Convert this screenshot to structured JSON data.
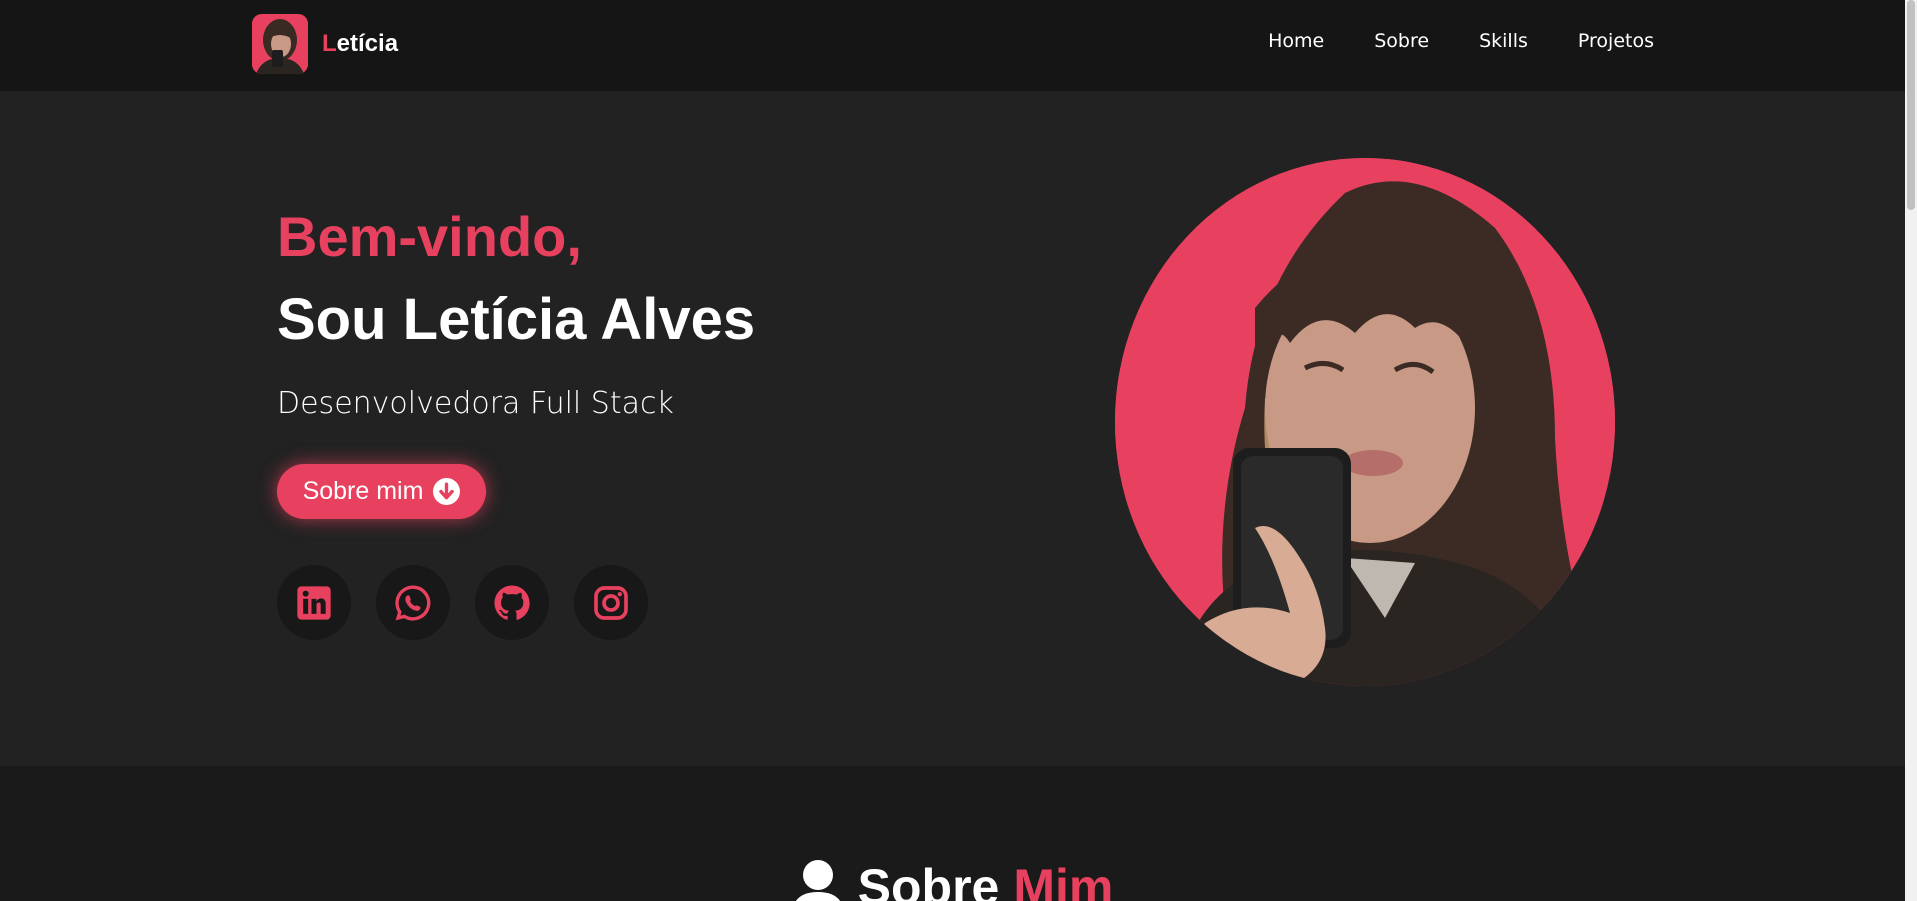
{
  "brand": {
    "first_letter": "L",
    "rest": "etícia",
    "logo_icon": "profile-photo"
  },
  "nav": {
    "items": [
      {
        "label": "Home"
      },
      {
        "label": "Sobre"
      },
      {
        "label": "Skills"
      },
      {
        "label": "Projetos"
      }
    ]
  },
  "hero": {
    "greeting": "Bem-vindo,",
    "name": "Sou Letícia Alves",
    "role": "Desenvolvedora Full Stack",
    "cta_label": "Sobre mim",
    "cta_icon": "arrow-circle-down-icon",
    "photo": "profile-photo",
    "socials": [
      {
        "icon": "linkedin-icon"
      },
      {
        "icon": "whatsapp-icon"
      },
      {
        "icon": "github-icon"
      },
      {
        "icon": "instagram-icon"
      }
    ]
  },
  "about": {
    "icon": "user-icon",
    "title_part1": "Sobre",
    "title_part2": "Mim"
  },
  "colors": {
    "accent": "#e8415f",
    "header_bg": "#151515",
    "hero_bg": "#222222",
    "section_bg": "#1a1a1a",
    "social_bg": "#181818",
    "text": "#ffffff"
  }
}
